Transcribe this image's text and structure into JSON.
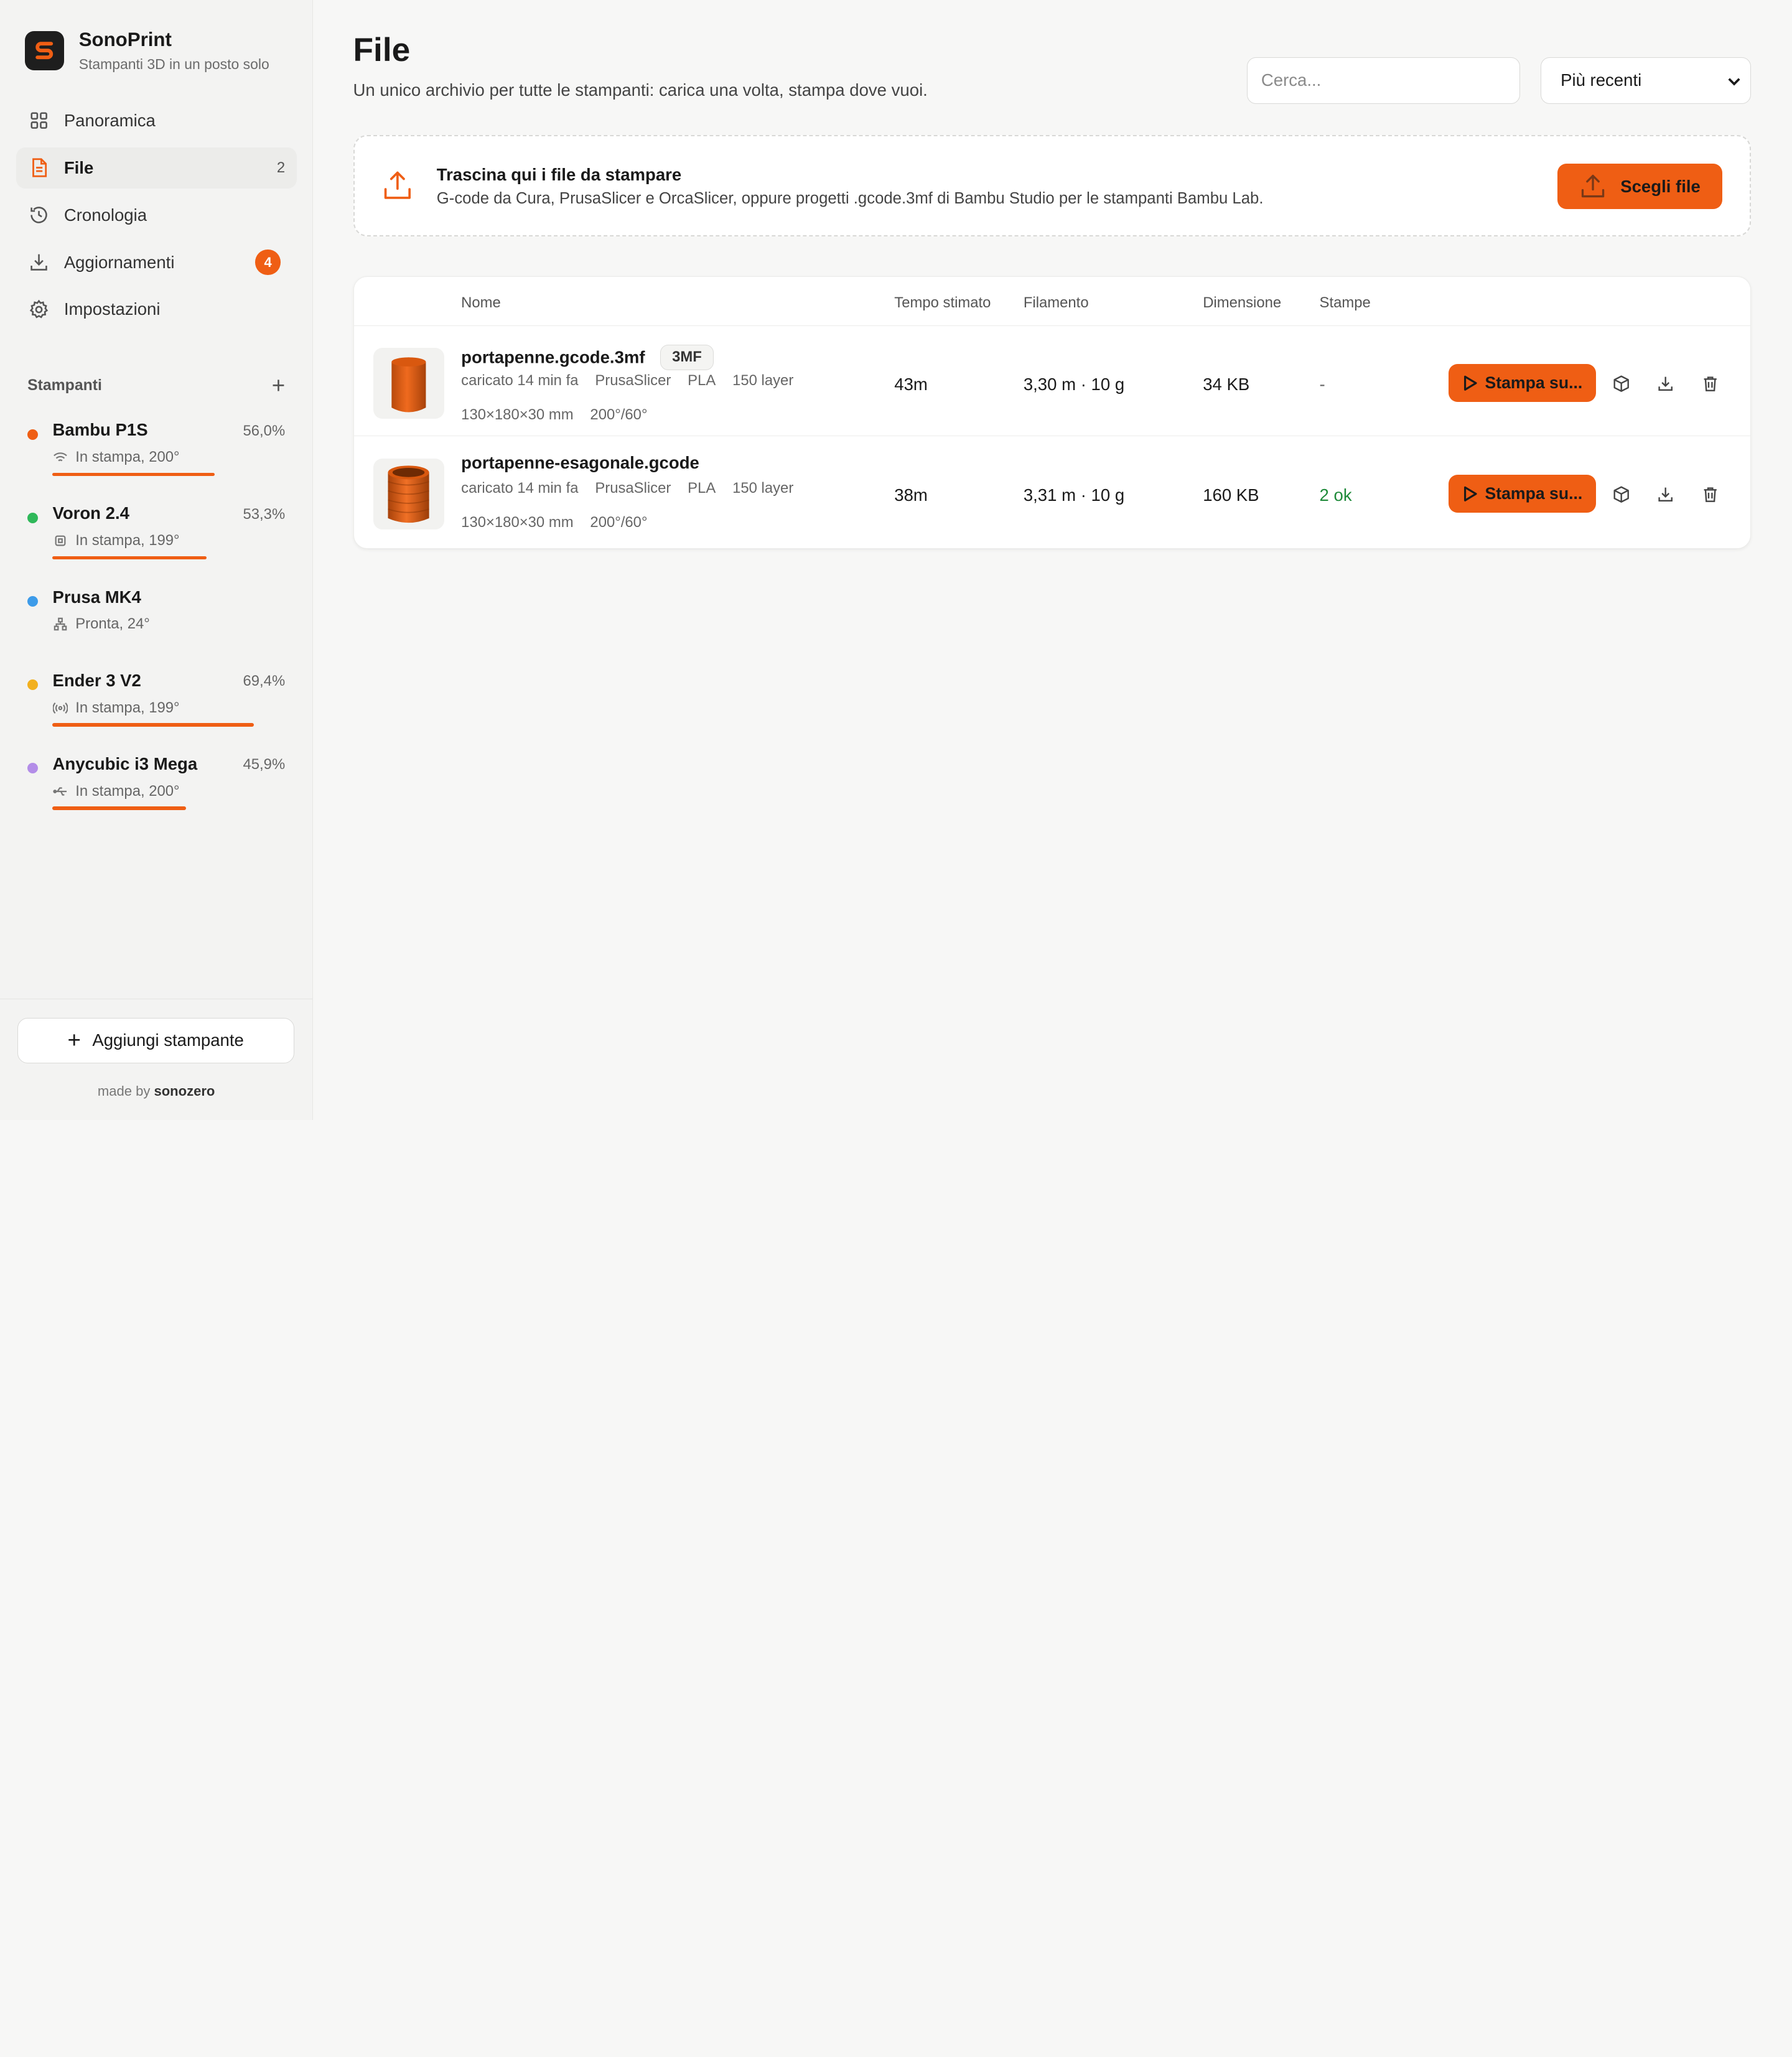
{
  "brand": {
    "name": "SonoPrint",
    "tagline": "Stampanti 3D in un posto solo"
  },
  "nav": [
    {
      "label": "Panoramica",
      "icon": "grid-icon"
    },
    {
      "label": "File",
      "icon": "file-icon",
      "count": "2",
      "active": true
    },
    {
      "label": "Cronologia",
      "icon": "history-icon"
    },
    {
      "label": "Aggiornamenti",
      "icon": "download-icon",
      "badge": "4"
    },
    {
      "label": "Impostazioni",
      "icon": "gear-icon"
    }
  ],
  "printers_section": {
    "title": "Stampanti",
    "add_symbol": "+"
  },
  "printers": [
    {
      "name": "Bambu P1S",
      "percent": "56,0%",
      "progress": 0.56,
      "status": "In stampa, 200°",
      "conn_icon": "wifi-icon",
      "color": "#ef5e14"
    },
    {
      "name": "Voron 2.4",
      "percent": "53,3%",
      "progress": 0.533,
      "status": "In stampa, 199°",
      "conn_icon": "chip-icon",
      "color": "#2fb85a"
    },
    {
      "name": "Prusa MK4",
      "percent": "",
      "progress": 0,
      "status": "Pronta, 24°",
      "conn_icon": "network-icon",
      "color": "#3d9be9"
    },
    {
      "name": "Ender 3 V2",
      "percent": "69,4%",
      "progress": 0.694,
      "status": "In stampa, 199°",
      "conn_icon": "radio-icon",
      "color": "#f2b01e"
    },
    {
      "name": "Anycubic i3 Mega",
      "percent": "45,9%",
      "progress": 0.459,
      "status": "In stampa, 200°",
      "conn_icon": "usb-icon",
      "color": "#b38de8"
    }
  ],
  "footer": {
    "add_printer": "Aggiungi stampante",
    "made_by_prefix": "made by",
    "made_by_name": "sonozero"
  },
  "page": {
    "title": "File",
    "subtitle": "Un unico archivio per tutte le stampanti: carica una volta, stampa dove vuoi."
  },
  "search": {
    "placeholder": "Cerca..."
  },
  "sort": {
    "selected": "Più recenti"
  },
  "dropzone": {
    "title": "Trascina qui i file da stampare",
    "subtitle": "G-code da Cura, PrusaSlicer e OrcaSlicer, oppure progetti .gcode.3mf di Bambu Studio per le stampanti Bambu Lab.",
    "button": "Scegli file"
  },
  "table": {
    "columns": [
      "Nome",
      "Tempo stimato",
      "Filamento",
      "Dimensione",
      "Stampe"
    ],
    "rows": [
      {
        "name": "portapenne.gcode.3mf",
        "tag": "3MF",
        "uploaded": "caricato 14 min fa",
        "slicer": "PrusaSlicer",
        "material": "PLA",
        "layers": "150 layer",
        "dims": "130×180×30 mm",
        "temps": "200°/60°",
        "time": "43m",
        "filament": "3,30 m · 10 g",
        "size": "34 KB",
        "prints": "-",
        "action": "Stampa su..."
      },
      {
        "name": "portapenne-esagonale.gcode",
        "tag": "",
        "uploaded": "caricato 14 min fa",
        "slicer": "PrusaSlicer",
        "material": "PLA",
        "layers": "150 layer",
        "dims": "130×180×30 mm",
        "temps": "200°/60°",
        "time": "38m",
        "filament": "3,31 m · 10 g",
        "size": "160 KB",
        "prints": "2 ok",
        "action": "Stampa su..."
      }
    ]
  },
  "colors": {
    "accent": "#ef5e14",
    "ok": "#1f8a3a"
  }
}
